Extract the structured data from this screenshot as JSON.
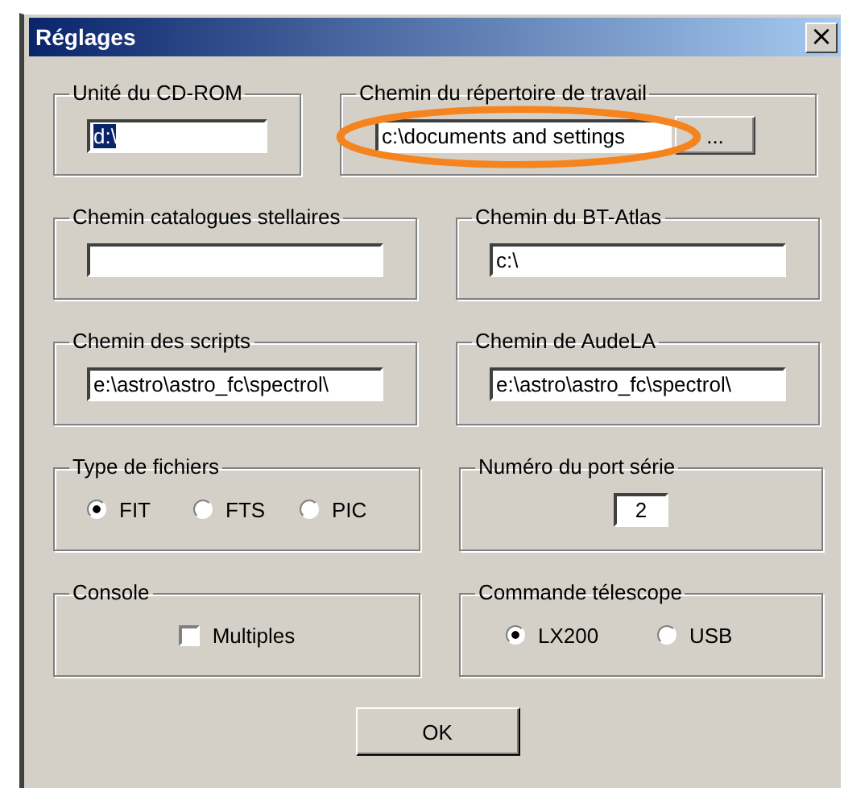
{
  "window": {
    "title": "Réglages",
    "close": "×"
  },
  "rows": [
    [
      {
        "kind": "text",
        "label": "Unité du CD-ROM",
        "value": "d:\\",
        "text_selected": true
      },
      {
        "kind": "browse",
        "label": "Chemin du répertoire de travail",
        "value": "c:\\documents and settings",
        "button": "...",
        "circled": true
      }
    ],
    [
      {
        "kind": "text",
        "label": "Chemin catalogues stellaires"
      },
      {
        "kind": "text",
        "label": "Chemin du BT-Atlas",
        "value": "c:\\",
        "text_selected": false
      }
    ],
    [
      {
        "kind": "text",
        "label": "Chemin des scripts",
        "value": "e:\\astro\\astro_fc\\spectrol\\",
        "text_selected": false
      },
      {
        "kind": "text",
        "label": "Chemin de AudeLA",
        "value": "e:\\astro\\astro_fc\\spectrol\\",
        "text_selected": false
      }
    ],
    [
      {
        "kind": "radio",
        "label": "Type de fichiers",
        "options": [
          {
            "label": "FIT",
            "selected": true
          },
          {
            "label": "FTS",
            "selected": false
          },
          {
            "label": "PIC",
            "selected": false
          }
        ]
      },
      {
        "kind": "number",
        "label": "Numéro du port série",
        "value": "2"
      }
    ],
    [
      {
        "kind": "checkbox",
        "label": "Console",
        "option": {
          "label": "Multiples",
          "checked": false
        }
      },
      {
        "kind": "radio",
        "label": "Commande télescope",
        "options": [
          {
            "label": "LX200",
            "selected": true
          },
          {
            "label": "USB",
            "selected": false
          }
        ]
      }
    ]
  ],
  "ok_button": "OK"
}
